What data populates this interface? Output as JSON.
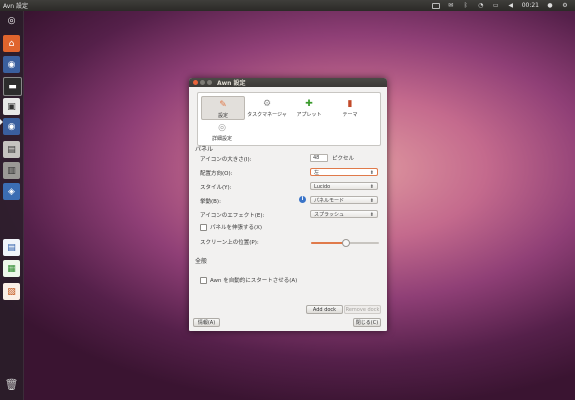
{
  "top_panel": {
    "app_name": "Avn 設定",
    "time": "00:21",
    "tray_icons": [
      "keyboard-icon",
      "mail-icon",
      "bluetooth-icon",
      "wifi-icon",
      "battery-icon",
      "volume-icon",
      "user-icon",
      "gear-icon"
    ]
  },
  "launcher": {
    "icons": [
      "dash-icon",
      "home-folder-icon",
      "firefox-icon",
      "terminal-icon",
      "tray-icon",
      "firefox-icon",
      "files-icon",
      "usb-drive-icon",
      "network-icon",
      "writer-icon",
      "calc-icon",
      "impress-icon",
      "trash-icon"
    ]
  },
  "dialog": {
    "title": "Awn 設定",
    "tabs": [
      {
        "label": "設定",
        "icon": "preferences-icon"
      },
      {
        "label": "タスクマネージャ",
        "icon": "task-manager-icon"
      },
      {
        "label": "アプレット",
        "icon": "applet-icon"
      },
      {
        "label": "テーマ",
        "icon": "theme-icon"
      },
      {
        "label": "詳細設定",
        "icon": "advanced-icon"
      }
    ],
    "panel": {
      "section_label": "パネル",
      "icon_size_label": "アイコンの大きさ(I):",
      "icon_size_value": "48",
      "icon_size_unit": "ピクセル",
      "orientation_label": "配置方向(O):",
      "orientation_value": "左",
      "style_label": "スタイル(Y):",
      "style_value": "Lucido",
      "behavior_label": "挙動(B):",
      "behavior_value": "パネルモード",
      "effect_label": "アイコンのエフェクト(E):",
      "effect_value": "スプラッシュ",
      "expand_label": "パネルを伸張する(X)",
      "expand_checked": false,
      "position_label": "スクリーン上の位置(P):",
      "position_value": 0.5
    },
    "general": {
      "section_label": "全般",
      "autostart_label": "Awn を自動的にスタートさせる(A)",
      "autostart_checked": false
    },
    "buttons": {
      "add_dock": "Add dock",
      "remove_dock": "Remove dock",
      "about": "情報(A)",
      "close": "閉じる(C)"
    }
  },
  "colors": {
    "accent": "#e07a4a",
    "panel_bg": "#2b2a27",
    "dialog_bg": "#f2f1f0"
  }
}
